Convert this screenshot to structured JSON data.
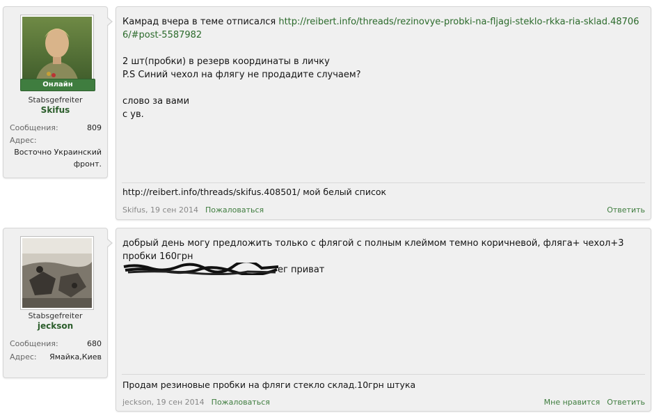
{
  "posts": [
    {
      "user": {
        "online_label": "Онлайн",
        "rank": "Stabsgefreiter",
        "name": "Skifus",
        "stats": {
          "messages_label": "Сообщения:",
          "messages_value": "809",
          "address_label": "Адрес:",
          "address_value": "Восточно Украинский фронт."
        }
      },
      "body": {
        "line1_prefix": "Камрад вчера в теме отписался ",
        "line1_link": "http://reibert.info/threads/rezinovye-probki-na-fljagi-steklo-rkka-ria-sklad.487066/#post-5587982",
        "line2": "2 шт(пробки) в резерв координаты в личку",
        "line3": "P.S Синий чехол на флягу не продадите случаем?",
        "line4": "слово за вами",
        "line5": "с ув."
      },
      "signature": "http://reibert.info/threads/skifus.408501/ мой белый список",
      "meta": {
        "author_date": "Skifus, 19 сен 2014",
        "report": "Пожаловаться"
      },
      "actions": {
        "reply": "Ответить"
      }
    },
    {
      "user": {
        "rank": "Stabsgefreiter",
        "name": "jeckson",
        "stats": {
          "messages_label": "Сообщения:",
          "messages_value": "680",
          "address_label": "Адрес:",
          "address_value": "Ямайка,Киев"
        }
      },
      "body": {
        "line1": "добрый день могу предложить только с флягой с полным клеймом темно коричневой, фляга+ чехол+3 пробки 160грн",
        "line2_visible": "ег приват"
      },
      "signature": "Продам резиновые пробки на фляги стекло склад.10грн штука",
      "meta": {
        "author_date": "jeckson, 19 сен 2014",
        "report": "Пожаловаться"
      },
      "actions": {
        "like": "Мне нравится",
        "reply": "Ответить"
      }
    }
  ],
  "colors": {
    "panel_bg": "#f0f0f0",
    "panel_border": "#d5d5d5",
    "accent_green": "#3f7d3f",
    "username_green": "#2b5d2b",
    "link_green": "#2b6a2b"
  }
}
